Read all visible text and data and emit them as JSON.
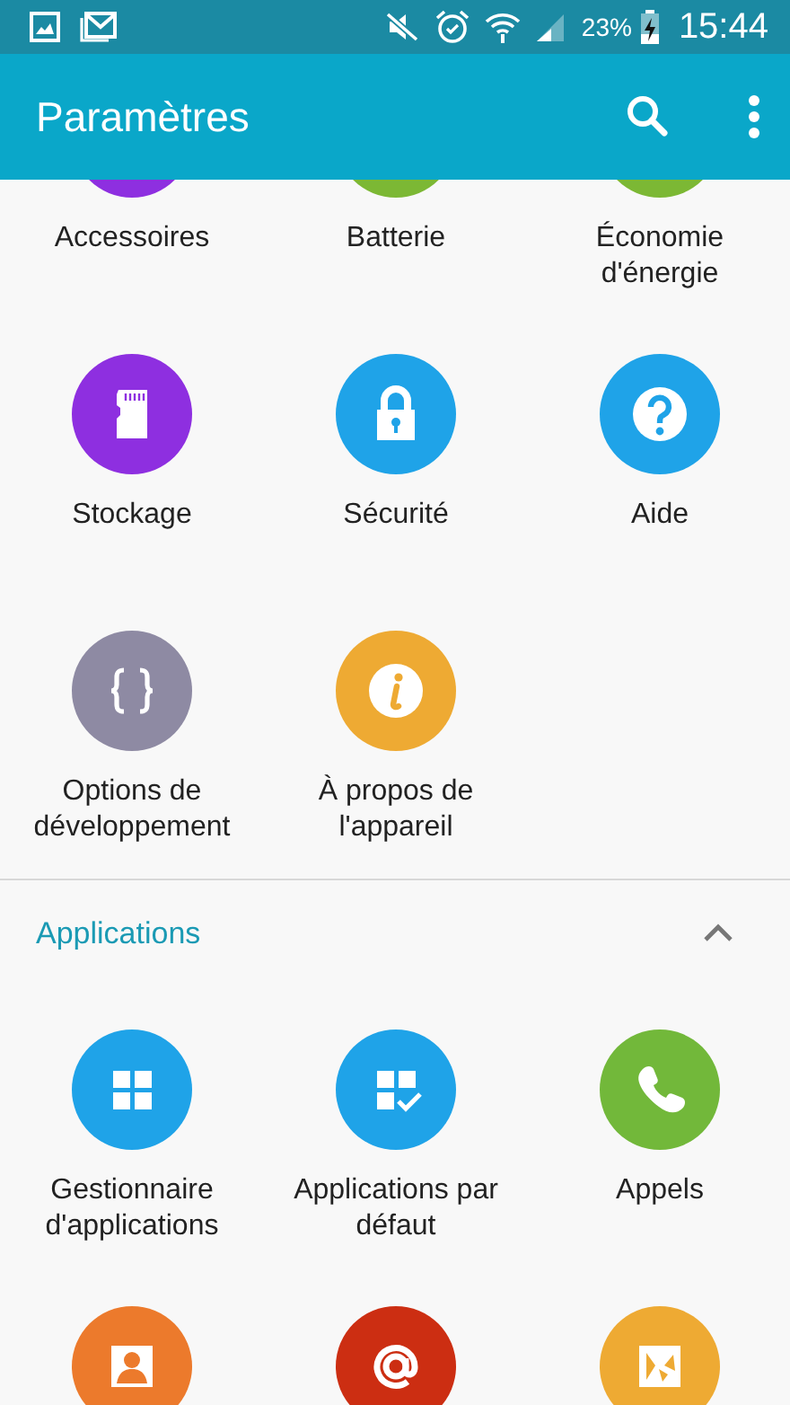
{
  "status_bar": {
    "battery": "23%",
    "time": "15:44"
  },
  "app_bar": {
    "title": "Paramètres"
  },
  "sections": [
    {
      "items": [
        {
          "label": "Accessoires",
          "color": "#8e2fe0",
          "kind": "plain"
        },
        {
          "label": "Batterie",
          "color": "#7cb834",
          "kind": "plain"
        },
        {
          "label": "Économie d'énergie",
          "color": "#7cb834",
          "kind": "plain"
        },
        {
          "label": "Stockage",
          "color": "#8e2fe0",
          "kind": "sdcard"
        },
        {
          "label": "Sécurité",
          "color": "#1fa3e8",
          "kind": "lock"
        },
        {
          "label": "Aide",
          "color": "#1fa3e8",
          "kind": "question"
        },
        {
          "label": "Options de développement",
          "color": "#8e8aa3",
          "kind": "braces"
        },
        {
          "label": "À propos de l'appareil",
          "color": "#eeaa33",
          "kind": "info"
        }
      ]
    },
    {
      "title": "Applications",
      "expanded": true,
      "items": [
        {
          "label": "Gestionnaire d'applications",
          "color": "#1fa3e8",
          "kind": "grid"
        },
        {
          "label": "Applications par défaut",
          "color": "#1fa3e8",
          "kind": "gridcheck"
        },
        {
          "label": "Appels",
          "color": "#72b83a",
          "kind": "phone"
        },
        {
          "color": "#ec7a2c",
          "kind": "contact"
        },
        {
          "color": "#cc2e12",
          "kind": "at"
        },
        {
          "color": "#eeaa33",
          "kind": "wallpaper"
        }
      ]
    }
  ]
}
